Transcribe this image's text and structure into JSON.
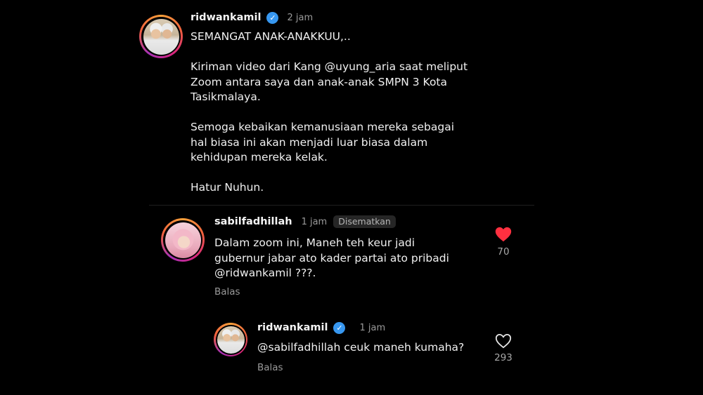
{
  "post": {
    "username": "ridwankamil",
    "time": "2 jam",
    "caption": "SEMANGAT ANAK-ANAKKUU,..\n\nKiriman video dari Kang @uyung_aria saat meliput\nZoom antara saya dan anak-anak SMPN 3 Kota\nTasikmalaya.\n\nSemoga kebaikan kemanusiaan mereka sebagai\nhal biasa ini akan menjadi luar biasa dalam\nkehidupan mereka kelak.\n\nHatur Nuhun."
  },
  "comments": [
    {
      "username": "sabilfadhillah",
      "time": "1 jam",
      "badge": "Disematkan",
      "text": "Dalam zoom ini, Maneh teh keur jadi\ngubernur jabar ato kader partai ato pribadi\n@ridwankamil ???.",
      "reply_label": "Balas",
      "likes": "70",
      "liked": true
    }
  ],
  "replies": [
    {
      "username": "ridwankamil",
      "time": "1 jam",
      "text": "@sabilfadhillah ceuk maneh kumaha?",
      "reply_label": "Balas",
      "likes": "293",
      "liked": false
    }
  ],
  "icons": {
    "verified": "✓",
    "heart_filled_color": "#ff3040",
    "verified_color": "#3797f0"
  }
}
